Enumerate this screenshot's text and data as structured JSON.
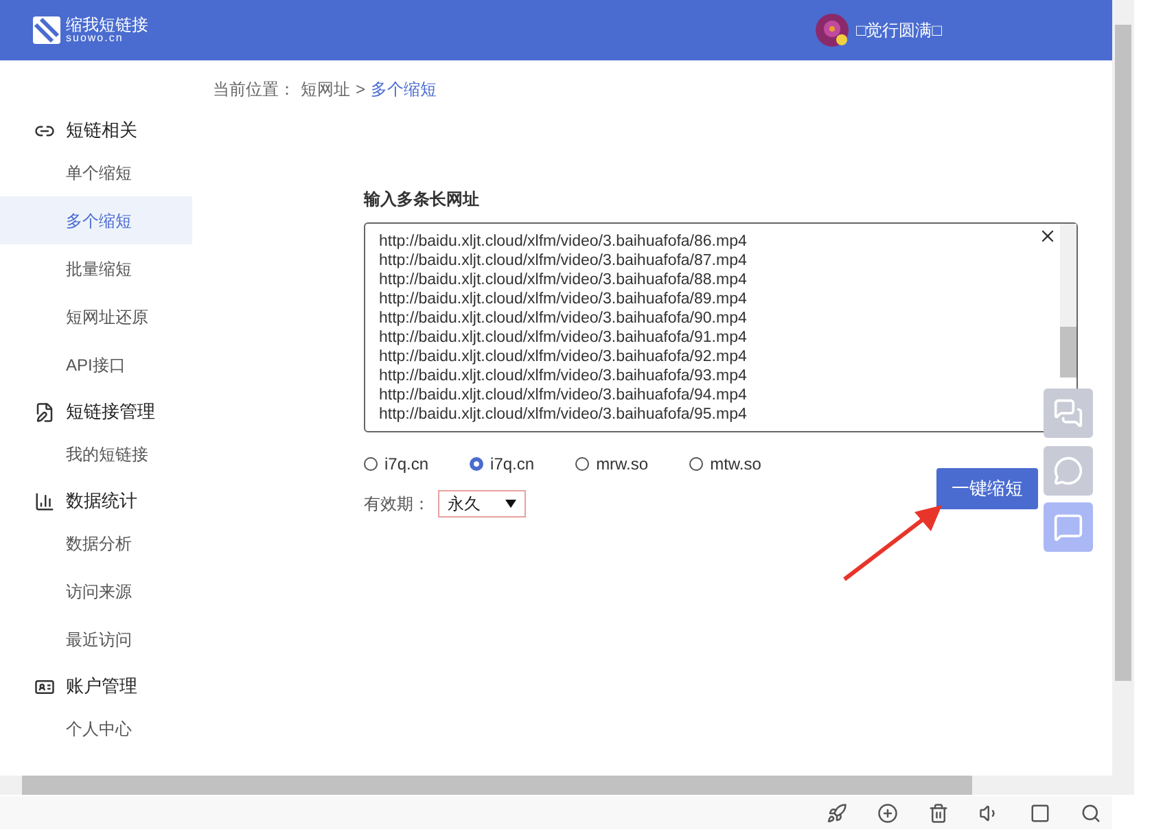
{
  "header": {
    "logo_title": "缩我短链接",
    "logo_subtitle": "suowo.cn",
    "user_name": "□觉行圆满□"
  },
  "breadcrumb": {
    "prefix": "当前位置：",
    "parent": "短网址",
    "separator": ">",
    "current": "多个缩短"
  },
  "sidebar": {
    "groups": [
      {
        "kind": "link",
        "title": "短链相关",
        "items": [
          {
            "label": "单个缩短",
            "selected": false
          },
          {
            "label": "多个缩短",
            "selected": true
          },
          {
            "label": "批量缩短",
            "selected": false
          },
          {
            "label": "短网址还原",
            "selected": false
          },
          {
            "label": "API接口",
            "selected": false
          }
        ]
      },
      {
        "kind": "manage",
        "title": "短链接管理",
        "items": [
          {
            "label": "我的短链接",
            "selected": false
          }
        ]
      },
      {
        "kind": "stats",
        "title": "数据统计",
        "items": [
          {
            "label": "数据分析",
            "selected": false
          },
          {
            "label": "访问来源",
            "selected": false
          },
          {
            "label": "最近访问",
            "selected": false
          }
        ]
      },
      {
        "kind": "account",
        "title": "账户管理",
        "items": [
          {
            "label": "个人中心",
            "selected": false
          }
        ]
      }
    ]
  },
  "form": {
    "label": "输入多条长网址",
    "urls": [
      "http://baidu.xljt.cloud/xlfm/video/3.baihuafofa/86.mp4",
      "http://baidu.xljt.cloud/xlfm/video/3.baihuafofa/87.mp4",
      "http://baidu.xljt.cloud/xlfm/video/3.baihuafofa/88.mp4",
      "http://baidu.xljt.cloud/xlfm/video/3.baihuafofa/89.mp4",
      "http://baidu.xljt.cloud/xlfm/video/3.baihuafofa/90.mp4",
      "http://baidu.xljt.cloud/xlfm/video/3.baihuafofa/91.mp4",
      "http://baidu.xljt.cloud/xlfm/video/3.baihuafofa/92.mp4",
      "http://baidu.xljt.cloud/xlfm/video/3.baihuafofa/93.mp4",
      "http://baidu.xljt.cloud/xlfm/video/3.baihuafofa/94.mp4",
      "http://baidu.xljt.cloud/xlfm/video/3.baihuafofa/95.mp4"
    ],
    "domains": [
      {
        "label": "i7q.cn",
        "selected": false
      },
      {
        "label": "i7q.cn",
        "selected": true
      },
      {
        "label": "mrw.so",
        "selected": false
      },
      {
        "label": "mtw.so",
        "selected": false
      }
    ],
    "validity_label": "有效期：",
    "validity_value": "永久",
    "submit": "一键缩短"
  }
}
